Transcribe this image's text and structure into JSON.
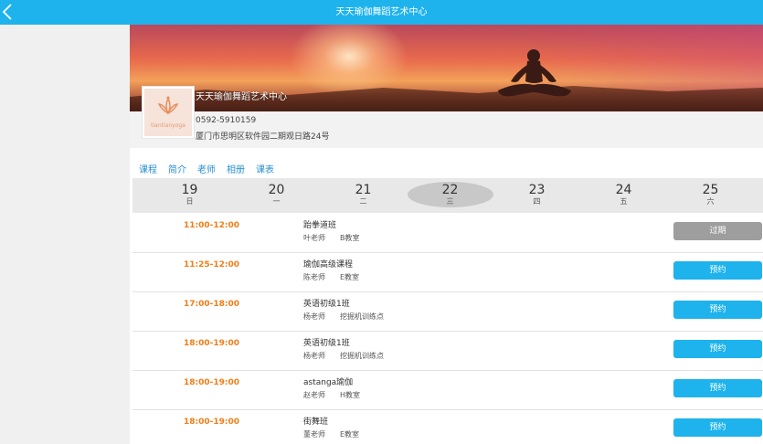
{
  "header": {
    "title": "天天瑜伽舞蹈艺术中心",
    "back_icon": "chevron-left-icon",
    "color": "#1eb3ec"
  },
  "studio": {
    "name": "天天瑜伽舞蹈艺术中心",
    "phone": "0592-5910159",
    "address": "厦门市思明区软件园二期观日路24号",
    "logo_text": "tiantianyoga"
  },
  "tabs": [
    {
      "label": "课程"
    },
    {
      "label": "简介"
    },
    {
      "label": "老师"
    },
    {
      "label": "相册"
    },
    {
      "label": "课表"
    }
  ],
  "days": [
    {
      "num": "19",
      "wk": "日",
      "selected": false
    },
    {
      "num": "20",
      "wk": "一",
      "selected": false
    },
    {
      "num": "21",
      "wk": "二",
      "selected": false
    },
    {
      "num": "22",
      "wk": "三",
      "selected": true
    },
    {
      "num": "23",
      "wk": "四",
      "selected": false
    },
    {
      "num": "24",
      "wk": "五",
      "selected": false
    },
    {
      "num": "25",
      "wk": "六",
      "selected": false
    }
  ],
  "classes": [
    {
      "time": "11:00-12:00",
      "name": "跆拳道班",
      "teacher": "叶老师",
      "room": "B教室",
      "action": "过期",
      "status": "expired"
    },
    {
      "time": "11:25-12:00",
      "name": "瑜伽高级课程",
      "teacher": "陈老师",
      "room": "E教室",
      "action": "预约",
      "status": "book"
    },
    {
      "time": "17:00-18:00",
      "name": "英语初级1班",
      "teacher": "杨老师",
      "room": "挖掘机训练点",
      "action": "预约",
      "status": "book"
    },
    {
      "time": "18:00-19:00",
      "name": "英语初级1班",
      "teacher": "杨老师",
      "room": "挖掘机训练点",
      "action": "预约",
      "status": "book"
    },
    {
      "time": "18:00-19:00",
      "name": "astanga瑜伽",
      "teacher": "赵老师",
      "room": "H教室",
      "action": "预约",
      "status": "book"
    },
    {
      "time": "18:00-19:00",
      "name": "街舞班",
      "teacher": "董老师",
      "room": "E教室",
      "action": "预约",
      "status": "book"
    }
  ],
  "colors": {
    "accent": "#1eb3ec",
    "time": "#f07d16",
    "expired": "#9e9e9e"
  }
}
